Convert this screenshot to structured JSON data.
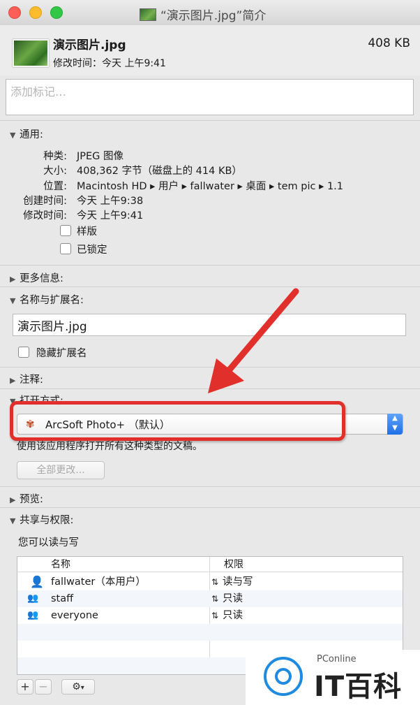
{
  "window": {
    "title": "“演示图片.jpg”简介",
    "filename": "演示图片.jpg",
    "modified_line": "修改时间：今天 上午9:41",
    "size": "408 KB",
    "tags_placeholder": "添加标记…"
  },
  "general": {
    "header": "通用:",
    "rows": [
      {
        "label": "种类:",
        "value": "JPEG 图像"
      },
      {
        "label": "大小:",
        "value": "408,362 字节（磁盘上的 414 KB）"
      },
      {
        "label": "位置:",
        "value": "Macintosh HD ▸ 用户 ▸ fallwater ▸ 桌面 ▸ tem pic ▸ 1.1"
      },
      {
        "label": "创建时间:",
        "value": "今天 上午9:38"
      },
      {
        "label": "修改时间:",
        "value": "今天 上午9:41"
      }
    ],
    "stationery": "样版",
    "locked": "已锁定"
  },
  "more_info": {
    "header": "更多信息:"
  },
  "name_ext": {
    "header": "名称与扩展名:",
    "value": "演示图片.jpg",
    "hide_ext": "隐藏扩展名"
  },
  "comments": {
    "header": "注释:"
  },
  "open_with": {
    "header": "打开方式:",
    "app": "ArcSoft Photo+ （默认）",
    "note": "使用该应用程序打开所有这种类型的文稿。",
    "change_all": "全部更改..."
  },
  "preview": {
    "header": "预览:"
  },
  "sharing": {
    "header": "共享与权限:",
    "summary": "您可以读与写",
    "col_name": "名称",
    "col_priv": "权限",
    "rows": [
      {
        "name": "fallwater（本用户）",
        "priv": "读与写"
      },
      {
        "name": "staff",
        "priv": "只读"
      },
      {
        "name": "everyone",
        "priv": "只读"
      }
    ],
    "add": "+",
    "remove": "−"
  },
  "watermark": {
    "brand_small": "PConline",
    "brand_text": "IT百科"
  },
  "colors": {
    "annotation_red": "#e1302b",
    "accent_blue": "#1f6fe7"
  }
}
